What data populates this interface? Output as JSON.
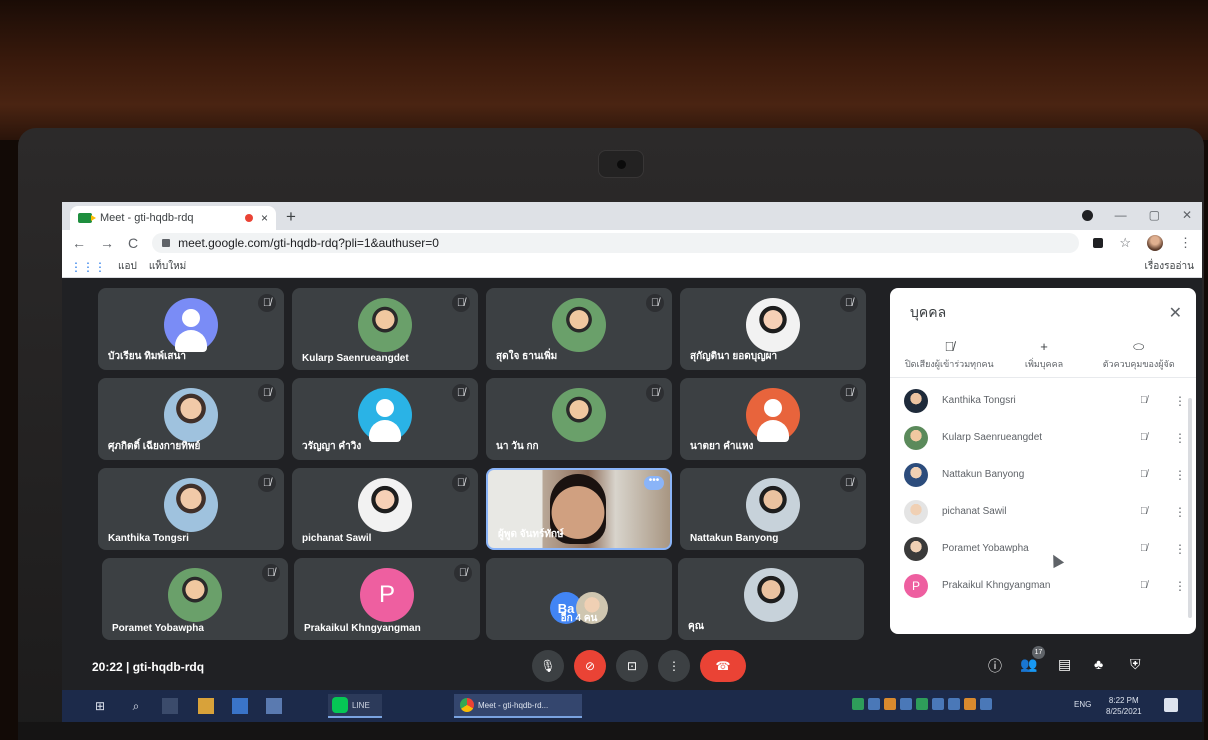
{
  "browser": {
    "tab_title": "Meet - gti-hqdb-rdq",
    "tab_close": "×",
    "new_tab": "+",
    "url": "meet.google.com/gti-hqdb-rdq?pli=1&authuser=0",
    "nav": {
      "back": "←",
      "forward": "→",
      "reload": "C"
    },
    "window_controls": {
      "minimize": "—",
      "restore": "▢",
      "close": "✕"
    },
    "bookmarks": {
      "apps": "⋮⋮⋮",
      "apps_label": "แอป",
      "new_tab_label": "แท็บใหม่",
      "reading_list": "เรื่องรออ่าน"
    },
    "menu": "⋮",
    "star": "☆"
  },
  "grid": {
    "tiles": [
      {
        "name": "บัวเรียน ทิมพ์เสนา",
        "avatar": "generic"
      },
      {
        "name": "Kularp Saenrueangdet",
        "avatar": "photo"
      },
      {
        "name": "สุดใจ ธานเพิ่ม",
        "avatar": "photo"
      },
      {
        "name": "สุกัญตินา ยอดบุญผา",
        "avatar": "photo"
      },
      {
        "name": "ศุภกิตติ์ เฉียงกายทิพย์",
        "avatar": "photo"
      },
      {
        "name": "วรัญญา คำวิง",
        "avatar": "generic"
      },
      {
        "name": "นา วัน กก",
        "avatar": "photo"
      },
      {
        "name": "นาตยา คำแหง",
        "avatar": "generic"
      },
      {
        "name": "Kanthika Tongsri",
        "avatar": "photo"
      },
      {
        "name": "pichanat Sawil",
        "avatar": "photo"
      },
      {
        "name": "ผู้พูด จันทร์ทักษ์",
        "avatar": "video"
      },
      {
        "name": "Nattakun Banyong",
        "avatar": "photo"
      },
      {
        "name": "Poramet Yobawpha",
        "avatar": "photo"
      },
      {
        "name": "Prakaikul Khngyangman",
        "avatar": "P"
      },
      {
        "name": "อีก 4 คน",
        "avatar": "Ba"
      },
      {
        "name": "คุณ",
        "avatar": "photo"
      }
    ],
    "more_dots": "•••",
    "muted_glyph": "🎙̸"
  },
  "panel": {
    "title": "บุคคล",
    "close": "✕",
    "actions": [
      {
        "icon": "🎙̸",
        "label": "ปิดเสียงผู้เข้าร่วมทุกคน"
      },
      {
        "icon": "+",
        "label": "เพิ่มบุคคล"
      },
      {
        "icon": "⬭",
        "label": "ตัวควบคุมของผู้จัด"
      }
    ],
    "people": [
      {
        "name": "Kanthika Tongsri",
        "initial": ""
      },
      {
        "name": "Kularp Saenrueangdet",
        "initial": ""
      },
      {
        "name": "Nattakun Banyong",
        "initial": ""
      },
      {
        "name": "pichanat Sawil",
        "initial": ""
      },
      {
        "name": "Poramet Yobawpha",
        "initial": ""
      },
      {
        "name": "Prakaikul Khngyangman",
        "initial": "P"
      }
    ],
    "mic_glyph": "🎙̸",
    "row_menu": "⋮"
  },
  "controls": {
    "meeting_info": "20:22 | gti-hqdb-rdq",
    "participant_count": "17",
    "mic": "🎙",
    "cam": "⊘",
    "present": "⊡",
    "more": "⋮",
    "hangup": "☎",
    "info": "ⓘ",
    "people": "👥",
    "chat": "▤",
    "activities": "♣",
    "safety": "⛨"
  },
  "taskbar": {
    "start": "⊞",
    "search": "⌕",
    "line_label": "LINE",
    "meet_label": "Meet - gti-hqdb-rd...",
    "lang": "ENG",
    "time": "8:22 PM",
    "date": "8/25/2021"
  }
}
